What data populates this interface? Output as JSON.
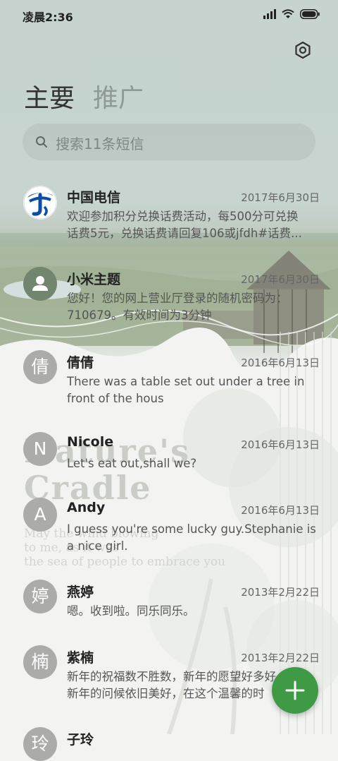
{
  "status_bar": {
    "time": "凌晨2:36"
  },
  "tabs": {
    "primary": "主要",
    "promotions": "推广"
  },
  "search": {
    "placeholder": "搜索11条短信"
  },
  "decor": {
    "title_line1": "Nature's",
    "title_line2": "Cradle",
    "line1": "May the wind blowing",
    "line2": "to me, as it was",
    "line3": "the sea of people to embrace you"
  },
  "conversations": [
    {
      "name": "中国电信",
      "date": "2017年6月30日",
      "preview_line1": "欢迎参加积分兑换话费活动，每500分可兑换",
      "preview_line2": "话费5元，兑换话费请回复106或jfdh#话费...",
      "avatar": "china-telecom-logo"
    },
    {
      "name": "小米主题",
      "date": "2017年6月30日",
      "preview_line1": "您好！您的网上营业厅登录的随机密码为：",
      "preview_line2": "710679。有效时间为3分钟",
      "avatar": "person-icon"
    },
    {
      "name": "倩倩",
      "date": "2016年6月13日",
      "preview_line1": "There was a table set out under a tree in",
      "preview_line2": "front of the hous",
      "initial": "倩"
    },
    {
      "name": "Nicole",
      "date": "2016年6月13日",
      "preview_line1": "Let's eat out,shall we?",
      "initial": "N"
    },
    {
      "name": "Andy",
      "date": "2016年6月13日",
      "preview_line1": "I guess you're some lucky guy.Stephanie is",
      "preview_line2": "a nice girl.",
      "initial": "A"
    },
    {
      "name": "燕婷",
      "date": "2013年2月22日",
      "preview_line1": "嗯。收到啦。同乐同乐。",
      "initial": "婷"
    },
    {
      "name": "紫楠",
      "date": "2013年2月22日",
      "preview_line1": "新年的祝福数不胜数，新年的愿望好多好",
      "preview_line2": "新年的问候依旧美好，在这个温馨的时",
      "initial": "楠"
    },
    {
      "name": "子玲",
      "initial": "玲"
    }
  ],
  "colors": {
    "accent": "#3f9a45",
    "avatar_gray": "#ababa9",
    "avatar_green": "#71856f",
    "telecom_blue": "#0a4ea8"
  }
}
